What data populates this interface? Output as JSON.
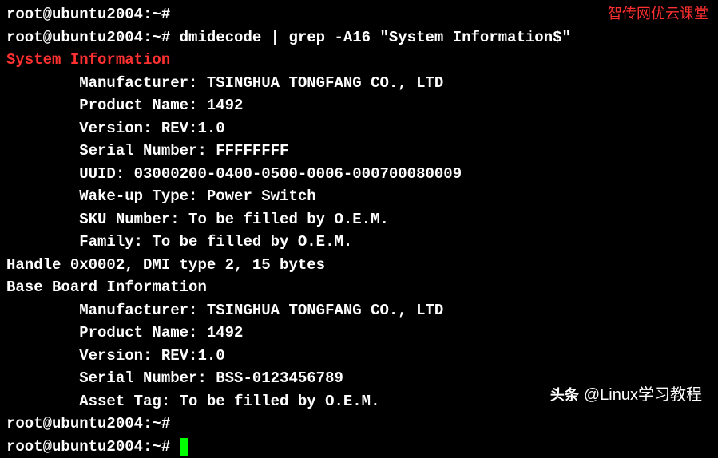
{
  "watermarks": {
    "top": "智传网优云课堂",
    "bottom_prefix": "头条",
    "bottom_handle": "@Linux学习教程"
  },
  "prompt": "root@ubuntu2004:~#",
  "command": " dmidecode | grep -A16 \"System Information$\"",
  "output": {
    "header": "System Information",
    "sys_manufacturer": "        Manufacturer: TSINGHUA TONGFANG CO., LTD",
    "sys_product": "        Product Name: 1492",
    "sys_version": "        Version: REV:1.0",
    "sys_serial": "        Serial Number: FFFFFFFF",
    "sys_uuid": "        UUID: 03000200-0400-0500-0006-000700080009",
    "sys_wakeup": "        Wake-up Type: Power Switch",
    "sys_sku": "        SKU Number: To be filled by O.E.M.",
    "sys_family": "        Family: To be filled by O.E.M.",
    "blank": "",
    "handle": "Handle 0x0002, DMI type 2, 15 bytes",
    "baseboard_header": "Base Board Information",
    "bb_manufacturer": "        Manufacturer: TSINGHUA TONGFANG CO., LTD",
    "bb_product": "        Product Name: 1492",
    "bb_version": "        Version: REV:1.0",
    "bb_serial": "        Serial Number: BSS-0123456789",
    "bb_asset": "        Asset Tag: To be filled by O.E.M."
  }
}
